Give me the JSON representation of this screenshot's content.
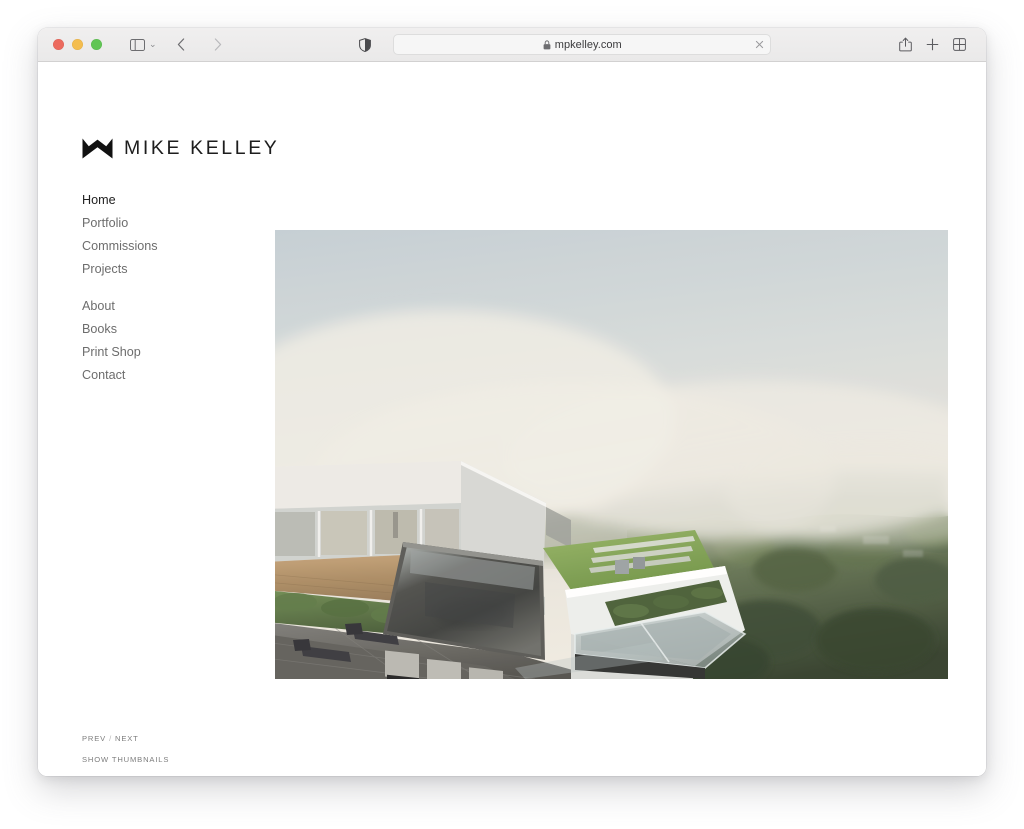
{
  "browser": {
    "traffic_lights": [
      "close",
      "minimize",
      "zoom"
    ],
    "sidebar_label": "Show sidebar",
    "tab_overview_chevron": "⌄",
    "back_label": "Back",
    "forward_label": "Forward",
    "privacy_label": "Privacy report",
    "address": {
      "value": "mpkelley.com",
      "placeholder": "Search or enter website name",
      "secure": true,
      "lock_icon": "lock-icon",
      "clear_icon": "close-icon"
    },
    "right_actions": [
      {
        "name": "share-button",
        "icon": "share-icon"
      },
      {
        "name": "new-tab-button",
        "icon": "plus-icon"
      },
      {
        "name": "tab-overview-button",
        "icon": "grid-icon"
      }
    ]
  },
  "site": {
    "brand": {
      "logo_icon": "mountain-chevron-logo",
      "name": "MIKE KELLEY"
    },
    "nav_primary": [
      {
        "label": "Home",
        "active": true
      },
      {
        "label": "Portfolio",
        "active": false
      },
      {
        "label": "Commissions",
        "active": false
      },
      {
        "label": "Projects",
        "active": false
      }
    ],
    "nav_secondary": [
      {
        "label": "About",
        "active": false
      },
      {
        "label": "Books",
        "active": false
      },
      {
        "label": "Print Shop",
        "active": false
      },
      {
        "label": "Contact",
        "active": false
      }
    ],
    "footer": {
      "prev": "PREV",
      "separator": "/",
      "next": "NEXT",
      "thumbnails": "SHOW THUMBNAILS"
    },
    "hero_photo": {
      "alt": "Modern hillside house with infinity pool overlooking a misty canyon",
      "colors": {
        "sky": "#cfd6d8",
        "mist": "#e8e6e0",
        "foliage": "#4d5c3c",
        "concrete": "#6c6c6a",
        "pool": "#4a4f50"
      }
    }
  }
}
